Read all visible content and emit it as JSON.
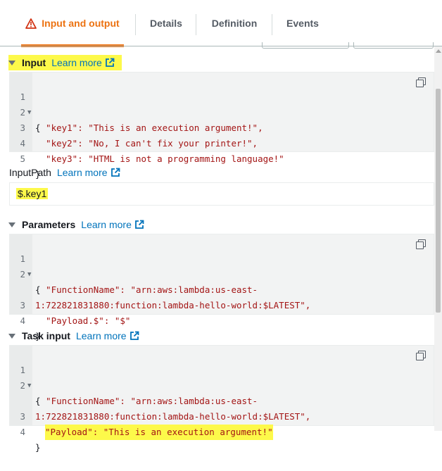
{
  "tabs": [
    {
      "label": "Input and output",
      "icon": "warning-icon",
      "active": true
    },
    {
      "label": "Details"
    },
    {
      "label": "Definition"
    },
    {
      "label": "Events"
    }
  ],
  "colors": {
    "accent": "#ec7211",
    "link": "#0073bb",
    "highlight": "#fdf94a"
  },
  "input": {
    "title": "Input",
    "learn_more": "Learn more",
    "lines": [
      {
        "n": "1",
        "text": "{"
      },
      {
        "n": "2",
        "text": "  \"key1\": \"This is an execution argument!\","
      },
      {
        "n": "3",
        "text": "  \"key2\": \"No, I can't fix your printer!\","
      },
      {
        "n": "4",
        "text": "  \"key3\": \"HTML is not a programming language!\""
      },
      {
        "n": "5",
        "text": "}"
      }
    ]
  },
  "inputpath": {
    "label": "InputPath",
    "learn_more": "Learn more",
    "value": "$.key1"
  },
  "parameters": {
    "title": "Parameters",
    "learn_more": "Learn more",
    "lines": [
      {
        "n": "1",
        "text": "{"
      },
      {
        "n": "2",
        "text": "  \"FunctionName\": \"arn:aws:lambda:us-east-"
      },
      {
        "n": "",
        "text": "1:722821831880:function:lambda-hello-world:$LATEST\","
      },
      {
        "n": "3",
        "text": "  \"Payload.$\": \"$\""
      },
      {
        "n": "4",
        "text": "}"
      }
    ]
  },
  "task_input": {
    "title": "Task input",
    "learn_more": "Learn more",
    "lines": [
      {
        "n": "1",
        "text": "{"
      },
      {
        "n": "2",
        "text": "  \"FunctionName\": \"arn:aws:lambda:us-east-"
      },
      {
        "n": "",
        "text": "1:722821831880:function:lambda-hello-world:$LATEST\","
      },
      {
        "n": "3",
        "text": "\"Payload\": \"This is an execution argument!\""
      },
      {
        "n": "4",
        "text": "}"
      }
    ]
  }
}
